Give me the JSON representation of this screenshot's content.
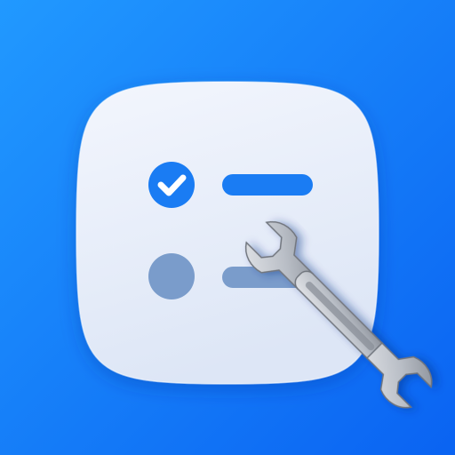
{
  "colors": {
    "background_top": "#2199ff",
    "background_bottom": "#0a63f2",
    "card_top": "#f3f6fd",
    "card_bottom": "#dde6f6",
    "accent": "#1a7cf3",
    "muted": "#7a9ccb",
    "check": "#ffffff",
    "wrench_light": "#e2e4e8",
    "wrench_dark": "#8a8f98"
  },
  "icons": {
    "check_item": "check-circle-icon",
    "empty_item": "empty-circle-icon",
    "tool": "wrench-icon"
  },
  "checklist": {
    "items": [
      {
        "state": "checked",
        "icon": "check-circle-icon"
      },
      {
        "state": "unchecked",
        "icon": "empty-circle-icon"
      }
    ]
  }
}
